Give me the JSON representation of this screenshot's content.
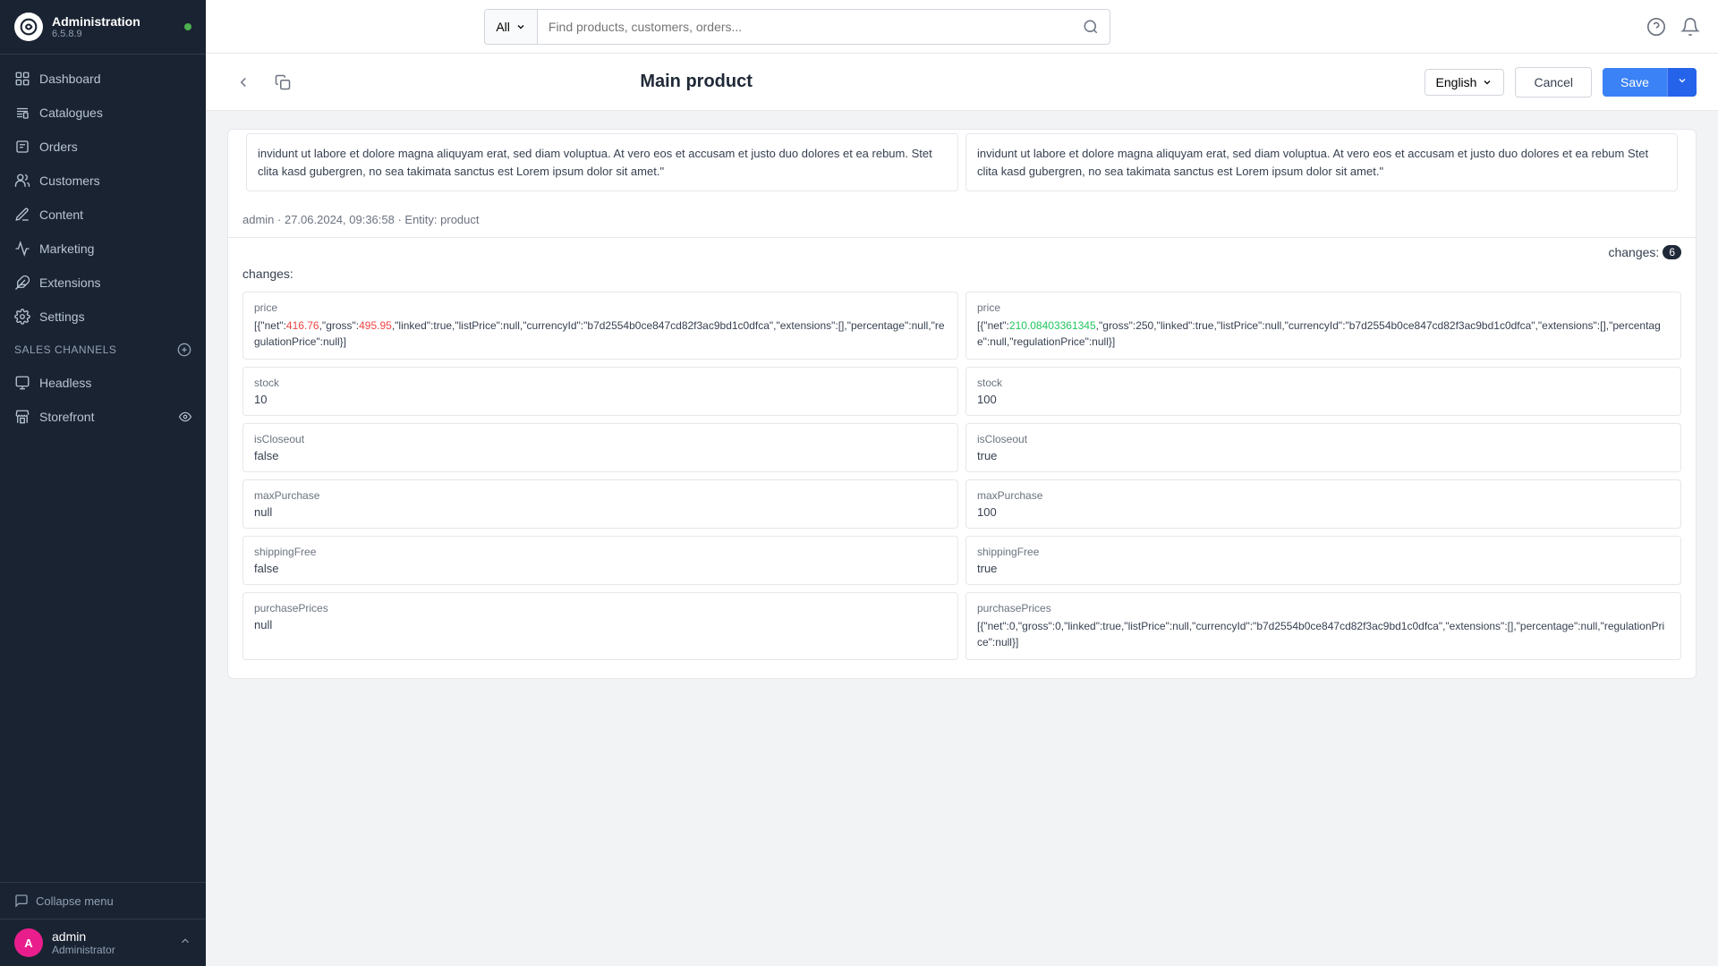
{
  "sidebar": {
    "app_name": "Administration",
    "version": "6.5.8.9",
    "nav_items": [
      {
        "id": "dashboard",
        "label": "Dashboard",
        "icon": "dashboard"
      },
      {
        "id": "catalogues",
        "label": "Catalogues",
        "icon": "catalogues"
      },
      {
        "id": "orders",
        "label": "Orders",
        "icon": "orders"
      },
      {
        "id": "customers",
        "label": "Customers",
        "icon": "customers"
      },
      {
        "id": "content",
        "label": "Content",
        "icon": "content"
      },
      {
        "id": "marketing",
        "label": "Marketing",
        "icon": "marketing"
      },
      {
        "id": "extensions",
        "label": "Extensions",
        "icon": "extensions"
      },
      {
        "id": "settings",
        "label": "Settings",
        "icon": "settings"
      }
    ],
    "sales_channels_label": "Sales Channels",
    "sales_channel_items": [
      {
        "id": "headless",
        "label": "Headless",
        "icon": "headless"
      },
      {
        "id": "storefront",
        "label": "Storefront",
        "icon": "storefront"
      }
    ],
    "collapse_label": "Collapse menu",
    "user": {
      "initial": "A",
      "name": "admin",
      "role": "Administrator"
    }
  },
  "topbar": {
    "search_type": "All",
    "search_placeholder": "Find products, customers, orders...",
    "chevron_icon": "▾"
  },
  "header": {
    "title": "Main product",
    "language": "English",
    "cancel_label": "Cancel",
    "save_label": "Save"
  },
  "changelog": {
    "meta": "admin · 27.06.2024, 09:36:58 · Entity: product",
    "changes_label": "changes:",
    "changes_count": "6",
    "description_old": "invidunt ut labore et dolore magna aliquyam erat, sed diam voluptua. At vero eos et accusam et justo duo dolores et ea rebum. Stet clita kasd gubergren, no sea takimata sanctus est Lorem ipsum dolor sit amet.\"",
    "description_new": "invidunt ut labore et dolore magna aliquyam erat, sed diam voluptua. At vero eos et accusam et justo duo dolores et ea rebum Stet clita kasd gubergren, no sea takimata sanctus est Lorem ipsum dolor sit amet.\"",
    "fields": [
      {
        "field": "price",
        "old_value": "[{\"net\":416.76,\"gross\":495.95,\"linked\":true,\"listPrice\":null,\"currencyId\":\"b7d2554b0ce847cd82f3ac9bd1c0dfca\",\"extensions\":[],\"percentage\":null,\"regulationPrice\":null}]",
        "old_highlights": [
          "416.76",
          "495.95"
        ],
        "new_value": "[{\"net\":210.08403361345,\"gross\":250,\"linked\":true,\"listPrice\":null,\"currencyId\":\"b7d2554b0ce847cd82f3ac9bd1c0dfca\",\"extensions\":[],\"percentage\":null,\"regulationPrice\":null}]",
        "new_highlights": [
          "210.08403361345"
        ]
      },
      {
        "field": "stock",
        "old_value": "10",
        "old_color": "neutral",
        "new_value": "100",
        "new_color": "green"
      },
      {
        "field": "isCloseout",
        "old_value": "false",
        "old_color": "red",
        "new_value": "true",
        "new_color": "green"
      },
      {
        "field": "maxPurchase",
        "old_value": "null",
        "old_color": "red",
        "new_value": "100",
        "new_color": "green"
      },
      {
        "field": "shippingFree",
        "old_value": "false",
        "old_color": "red",
        "new_value": "true",
        "new_color": "green"
      },
      {
        "field": "purchasePrices",
        "old_value": "null",
        "old_color": "neutral",
        "new_value": "[{\"net\":0,\"gross\":0,\"linked\":true,\"listPrice\":null,\"currencyId\":\"b7d2554b0ce847cd82f3ac9bd1c0dfca\",\"extensions\":[],\"percentage\":null,\"regulationPrice\":null}]",
        "new_color": "green"
      }
    ]
  }
}
